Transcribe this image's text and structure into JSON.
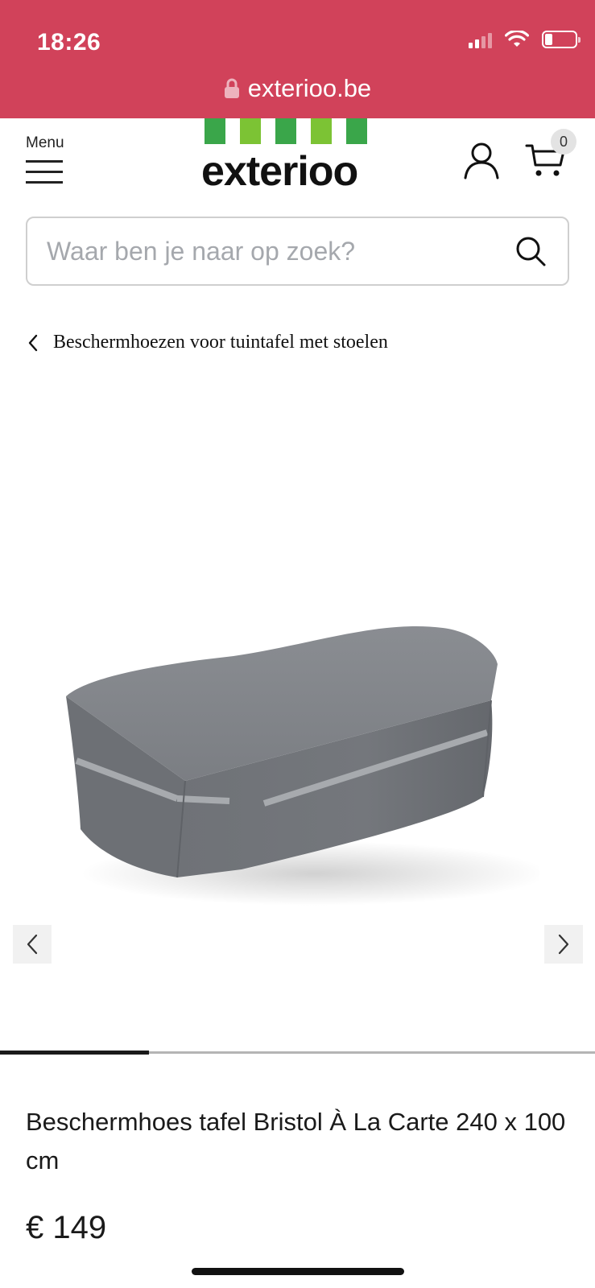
{
  "status_bar": {
    "time": "18:26",
    "signal_bars_active": 2,
    "signal_bars_total": 4,
    "battery_level": 0.25
  },
  "browser": {
    "url": "exterioo.be",
    "lock_icon": "lock-icon",
    "bar_color": "#d1425a"
  },
  "header": {
    "menu_label": "Menu",
    "logo_text": "exterioo",
    "logo_bar_colors": [
      "#3aa64a",
      "#7cc334",
      "#3aa64a",
      "#7cc334",
      "#3aa64a"
    ],
    "account_icon": "user-icon",
    "cart_icon": "cart-icon",
    "cart_count": "0"
  },
  "search": {
    "placeholder": "Waar ben je naar op zoek?",
    "value": ""
  },
  "breadcrumb": {
    "label": "Beschermhoezen voor tuintafel met stoelen"
  },
  "gallery": {
    "image_subject": "grey table cover",
    "current_slide_fraction": 0.25
  },
  "product": {
    "title": "Beschermhoes tafel Bristol À La Carte 240 x 100 cm",
    "price": "€ 149"
  }
}
